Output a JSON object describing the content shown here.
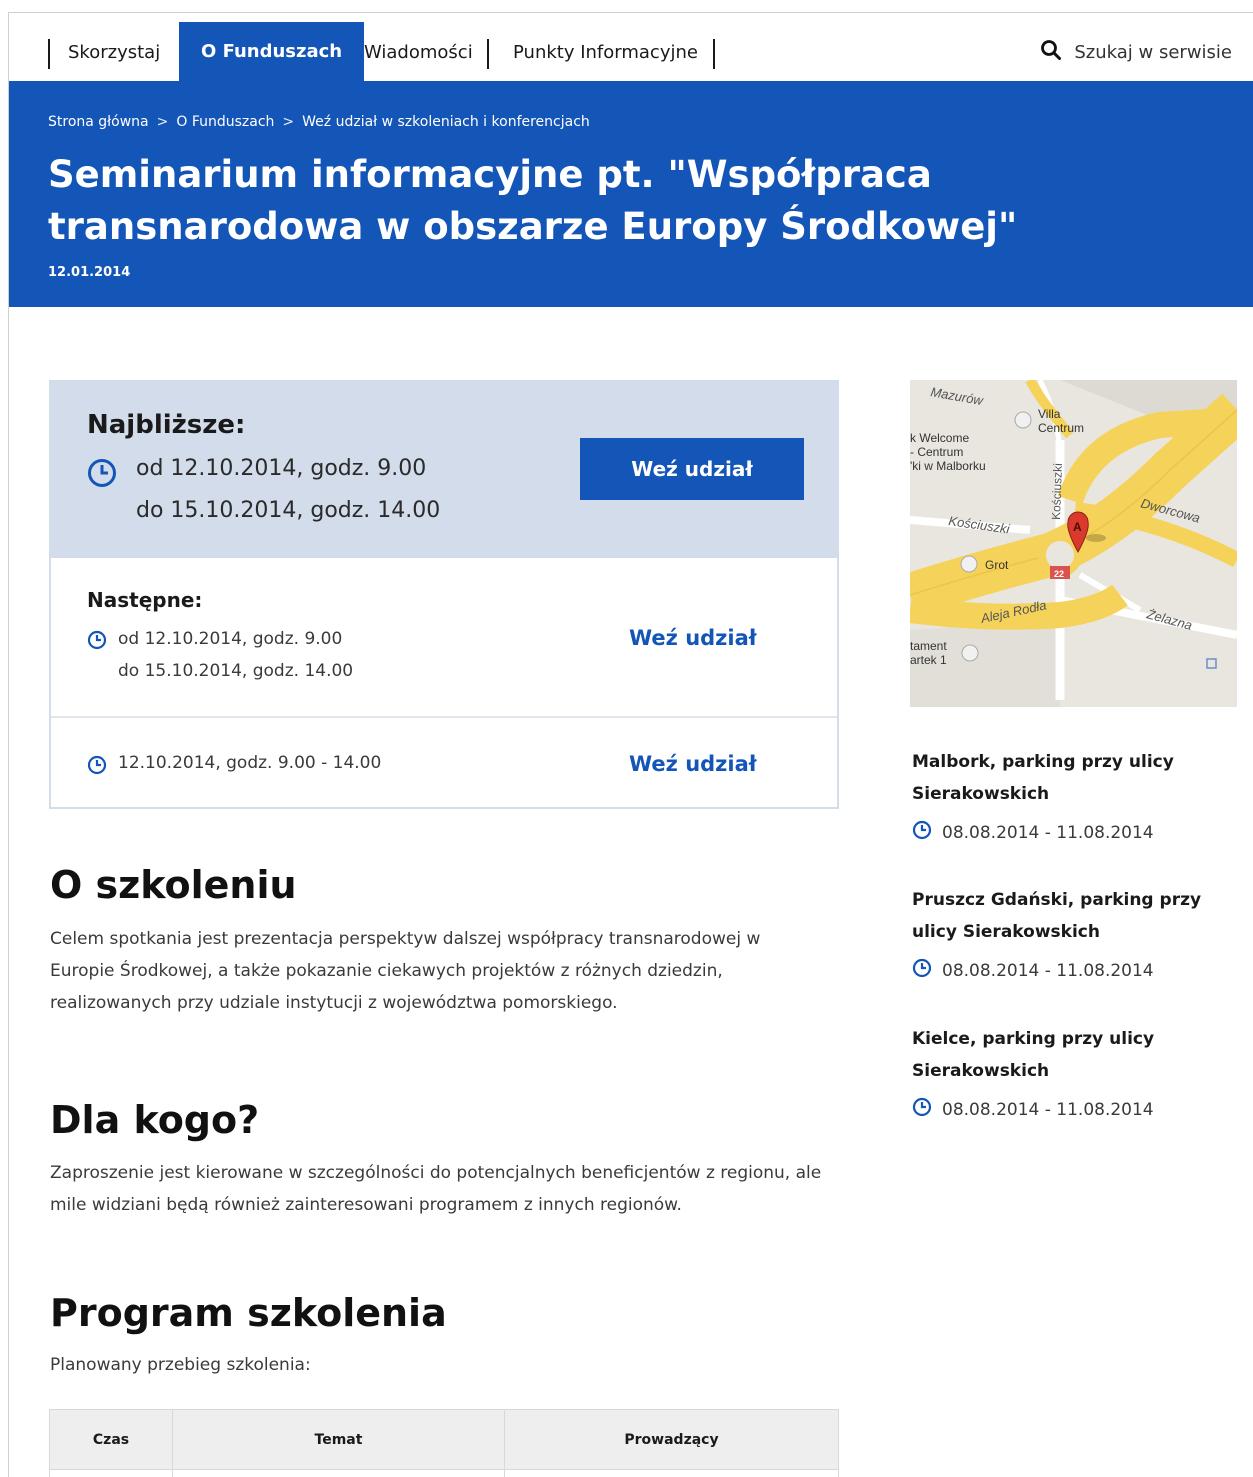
{
  "nav": {
    "items": [
      "Skorzystaj",
      "O Funduszach",
      "Wiadomości",
      "Punkty Informacyjne"
    ],
    "active_index": 1,
    "search_label": "Szukaj w serwisie"
  },
  "hero": {
    "breadcrumb": [
      "Strona główna",
      "O Funduszach",
      "Weź udział w szkoleniach i konferencjach"
    ],
    "breadcrumb_separator": ">",
    "title": "Seminarium informacyjne pt. \"Współpraca transnarodowa w obszarze Europy Środkowej\"",
    "date": "12.01.2014"
  },
  "events": {
    "primary": {
      "label": "Najbliższe:",
      "line1": "od 12.10.2014, godz. 9.00",
      "line2": "do 15.10.2014, godz. 14.00",
      "button": "Weź udział"
    },
    "next": {
      "label": "Następne:",
      "line1": "od 12.10.2014, godz. 9.00",
      "line2": "do 15.10.2014, godz. 14.00",
      "button": "Weź udział"
    },
    "other": {
      "line1": "12.10.2014, godz. 9.00 - 14.00",
      "button": "Weź udział"
    }
  },
  "about": {
    "heading": "O szkoleniu",
    "text": "Celem spotkania jest prezentacja perspektyw dalszej współpracy transnarodowej w Europie Środkowej, a także pokazanie ciekawych projektów z różnych dziedzin, realizowanych przy udziale instytucji z województwa pomorskiego."
  },
  "audience": {
    "heading": "Dla kogo?",
    "text": "Zaproszenie jest kierowane w szczególności do potencjalnych beneficjentów z regionu, ale mile widziani będą również zainteresowani programem z innych regionów."
  },
  "program": {
    "heading": "Program szkolenia",
    "intro": "Planowany przebieg szkolenia:",
    "columns": [
      "Czas",
      "Temat",
      "Prowadzący"
    ]
  },
  "map": {
    "labels": {
      "mazurow": "Mazurów",
      "villa": "Villa",
      "centrum": "Centrum",
      "welcome1": "k Welcome",
      "welcome2": "- Centrum",
      "welcome3": "'ki w Malborku",
      "kosciuszki_v": "Kościuszki",
      "kosciuszki_h": "Kościuszki",
      "dworcowa": "Dworcowa",
      "grot": "Grot",
      "road_number": "22",
      "aleja": "Aleja Rodła",
      "zelazna": "Żelazna",
      "tament1": "tament",
      "tament2": "artek 1",
      "marker": "A"
    },
    "colors": {
      "road": "#f5d35a",
      "ground": "#e9e6df",
      "marker": "#d93a2b"
    }
  },
  "sidebar": {
    "items": [
      {
        "title": "Malbork, parking przy ulicy Sierakowskich",
        "date": "08.08.2014 - 11.08.2014"
      },
      {
        "title": "Pruszcz Gdański, parking przy ulicy Sierakowskich",
        "date": "08.08.2014 - 11.08.2014"
      },
      {
        "title": "Kielce, parking przy ulicy Sierakowskich",
        "date": "08.08.2014 - 11.08.2014"
      }
    ]
  },
  "colors": {
    "brand": "#1455b8",
    "panel": "#d3dcea"
  }
}
